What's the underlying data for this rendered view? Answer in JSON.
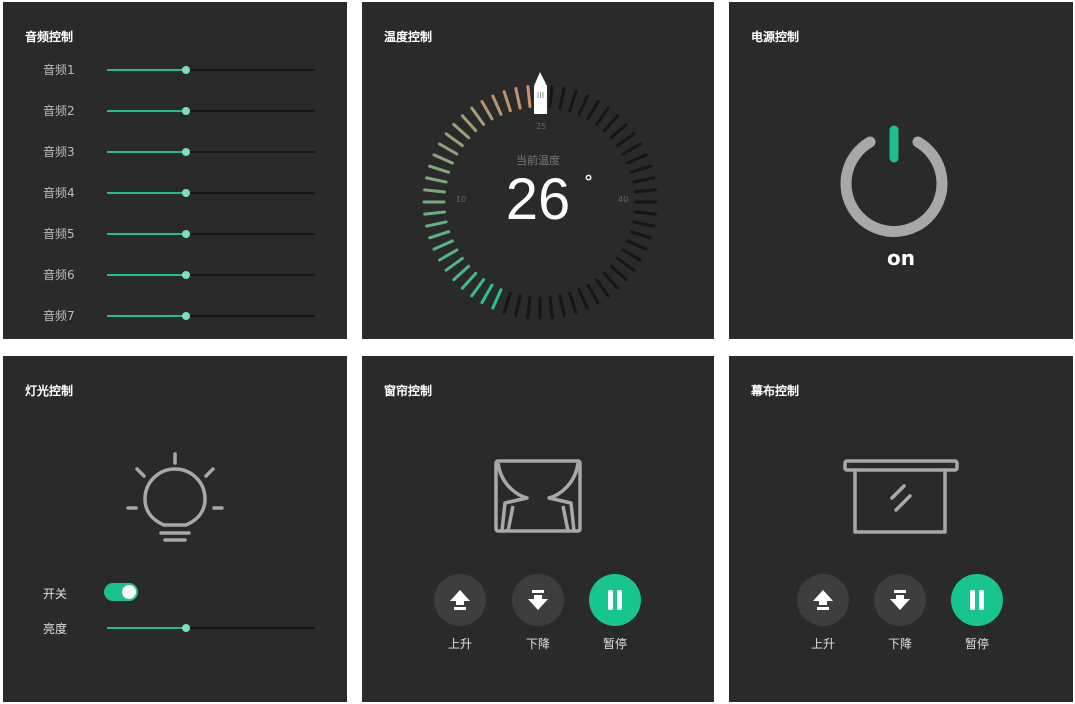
{
  "audio": {
    "title": "音频控制",
    "channels": [
      {
        "label": "音频1",
        "level": 0.38
      },
      {
        "label": "音频2",
        "level": 0.38
      },
      {
        "label": "音频3",
        "level": 0.38
      },
      {
        "label": "音频4",
        "level": 0.38
      },
      {
        "label": "音频5",
        "level": 0.38
      },
      {
        "label": "音频6",
        "level": 0.38
      },
      {
        "label": "音频7",
        "level": 0.38
      }
    ]
  },
  "temperature": {
    "title": "温度控制",
    "caption": "当前温度",
    "value": "26",
    "unit": "°",
    "scale_min_label": "10",
    "scale_mid_label": "25",
    "scale_max_label": "40",
    "current": 26,
    "min": 10,
    "max": 40
  },
  "power": {
    "title": "电源控制",
    "state_label": "on",
    "state_color": "#1dbf8e",
    "ring_color": "#a8a8a8"
  },
  "light": {
    "title": "灯光控制",
    "icon": "bulb-icon",
    "switch_label": "开关",
    "switch_on": true,
    "brightness_label": "亮度",
    "brightness": 0.38
  },
  "curtain": {
    "title": "窗帘控制",
    "icon": "curtain-icon",
    "buttons": [
      {
        "label": "上升",
        "icon": "arrow-up-icon",
        "active": false
      },
      {
        "label": "下降",
        "icon": "arrow-down-icon",
        "active": false
      },
      {
        "label": "暂停",
        "icon": "pause-icon",
        "active": true
      }
    ]
  },
  "screen": {
    "title": "幕布控制",
    "icon": "projection-screen-icon",
    "buttons": [
      {
        "label": "上升",
        "icon": "arrow-up-icon",
        "active": false
      },
      {
        "label": "下降",
        "icon": "arrow-down-icon",
        "active": false
      },
      {
        "label": "暂停",
        "icon": "pause-icon",
        "active": true
      }
    ]
  },
  "colors": {
    "panel_bg": "#2a2a2a",
    "accent": "#1dbf8e",
    "button_bg": "#3e3e3e",
    "active_button": "#18c48f"
  }
}
